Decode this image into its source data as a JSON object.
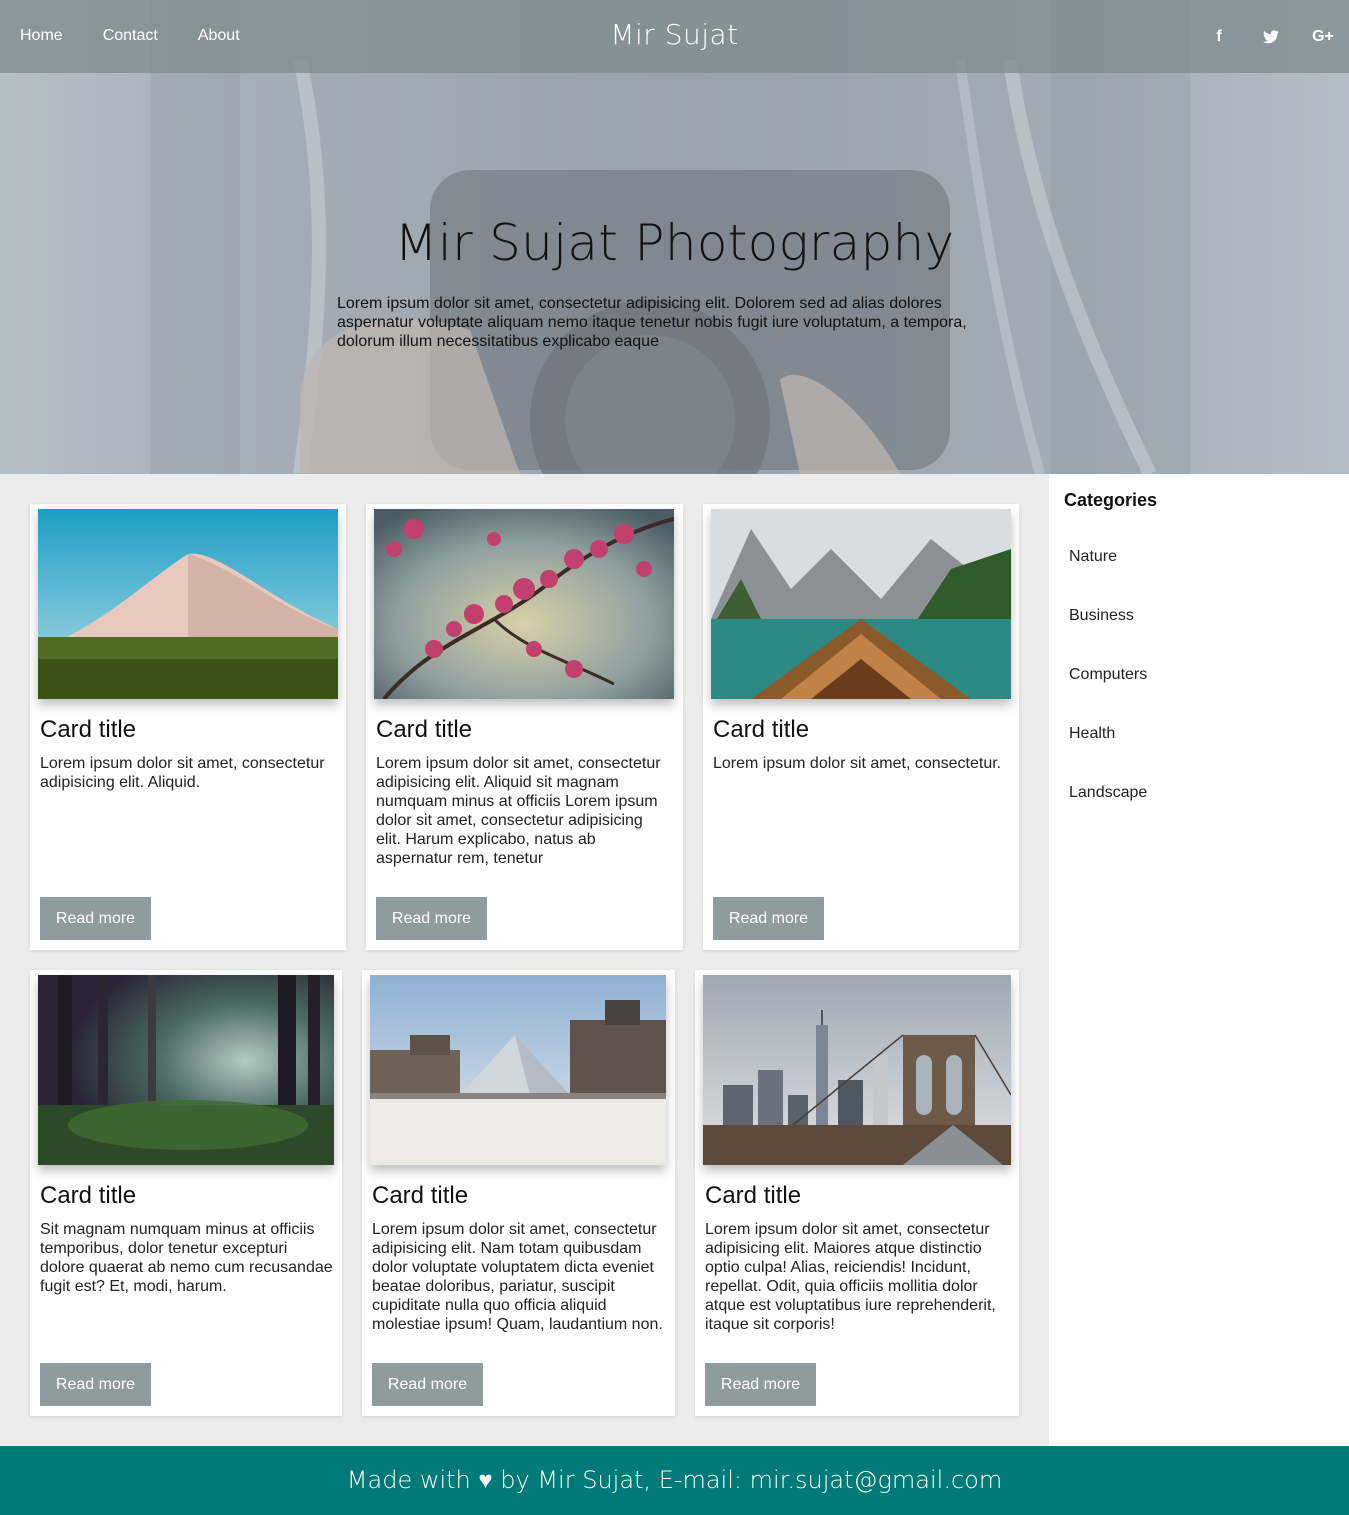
{
  "nav": {
    "links": [
      "Home",
      "Contact",
      "About"
    ],
    "brand": "Mir Sujat",
    "social": [
      {
        "icon": "facebook-icon",
        "glyph": "f"
      },
      {
        "icon": "twitter-icon",
        "glyph": "🐦"
      },
      {
        "icon": "google-plus-icon",
        "glyph": "G+"
      }
    ]
  },
  "hero": {
    "title": "Mir Sujat Photography",
    "text": "Lorem ipsum dolor sit amet, consectetur adipisicing elit. Dolorem sed ad alias dolores aspernatur voluptate aliquam nemo itaque tenetur nobis fugit iure voluptatum, a tempora, dolorum illum necessitatibus explicabo eaque"
  },
  "cards": [
    {
      "image": "desert-dune-image",
      "title": "Card title",
      "text": "Lorem ipsum dolor sit amet, consectetur adipisicing elit. Aliquid.",
      "button": "Read more"
    },
    {
      "image": "cherry-blossom-image",
      "title": "Card title",
      "text": "Lorem ipsum dolor sit amet, consectetur adipisicing elit. Aliquid sit magnam numquam minus at officiis Lorem ipsum dolor sit amet, consectetur adipisicing elit. Harum explicabo, natus ab aspernatur rem, tenetur",
      "button": "Read more"
    },
    {
      "image": "mountain-lake-boat-image",
      "title": "Card title",
      "text": "Lorem ipsum dolor sit amet, consectetur.",
      "button": "Read more"
    },
    {
      "image": "forest-image",
      "title": "Card title",
      "text": "Sit magnam numquam minus at officiis temporibus, dolor tenetur excepturi dolore quaerat ab nemo cum recusandae fugit est? Et, modi, harum.",
      "button": "Read more"
    },
    {
      "image": "louvre-pyramid-image",
      "title": "Card title",
      "text": "Lorem ipsum dolor sit amet, consectetur adipisicing elit. Nam totam quibusdam dolor voluptate voluptatem dicta eveniet beatae doloribus, pariatur, suscipit cupiditate nulla quo officia aliquid molestiae ipsum! Quam, laudantium non.",
      "button": "Read more"
    },
    {
      "image": "brooklyn-bridge-image",
      "title": "Card title",
      "text": "Lorem ipsum dolor sit amet, consectetur adipisicing elit. Maiores atque distinctio optio culpa! Alias, reiciendis! Incidunt, repellat. Odit, quia officiis mollitia dolor atque est voluptatibus iure reprehenderit, itaque sit corporis!",
      "button": "Read more"
    }
  ],
  "sidebar": {
    "title": "Categories",
    "items": [
      "Nature",
      "Business",
      "Computers",
      "Health",
      "Landscape"
    ]
  },
  "footer": {
    "text": "Made with ♥ by Mir Sujat, E-mail: mir.sujat@gmail.com"
  },
  "colors": {
    "navbar": "#7d8c91",
    "button": "#8f9c9c",
    "footer": "#007a78"
  }
}
